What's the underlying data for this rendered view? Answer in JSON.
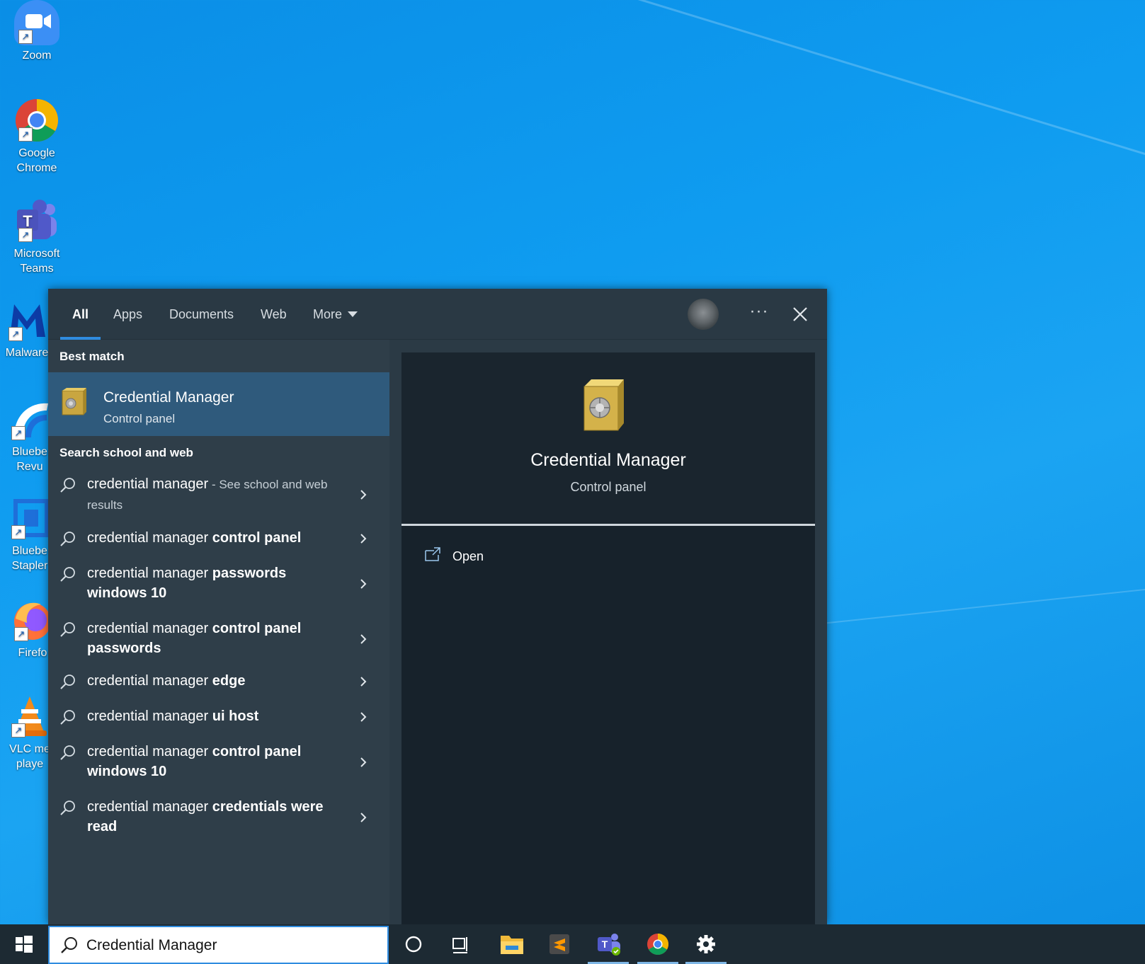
{
  "desktop": {
    "icons": [
      {
        "label": "Zoom"
      },
      {
        "label": "Google\nChrome"
      },
      {
        "label": "Microsoft\nTeams"
      },
      {
        "label": "Malware"
      },
      {
        "label": "Bluebe\nRevu"
      },
      {
        "label": "Bluebe\nStapler"
      },
      {
        "label": "Firefo"
      },
      {
        "label": "VLC me\nplaye"
      }
    ]
  },
  "search_panel": {
    "tabs": [
      {
        "label": "All",
        "active": true
      },
      {
        "label": "Apps"
      },
      {
        "label": "Documents"
      },
      {
        "label": "Web"
      },
      {
        "label": "More"
      }
    ],
    "more_options_label": "···",
    "best_match": {
      "heading": "Best match",
      "title": "Credential Manager",
      "subtitle": "Control panel"
    },
    "web_heading": "Search school and web",
    "results": [
      {
        "prefix": "credential manager",
        "bold": "",
        "hint": " - See school and web results"
      },
      {
        "prefix": "credential manager ",
        "bold": "control panel",
        "hint": ""
      },
      {
        "prefix": "credential manager ",
        "bold": "passwords windows 10",
        "hint": ""
      },
      {
        "prefix": "credential manager ",
        "bold": "control panel passwords",
        "hint": ""
      },
      {
        "prefix": "credential manager ",
        "bold": "edge",
        "hint": ""
      },
      {
        "prefix": "credential manager ",
        "bold": "ui host",
        "hint": ""
      },
      {
        "prefix": "credential manager ",
        "bold": "control panel windows 10",
        "hint": ""
      },
      {
        "prefix": "credential manager ",
        "bold": "credentials were read",
        "hint": ""
      }
    ],
    "preview": {
      "title": "Credential Manager",
      "subtitle": "Control panel",
      "actions": [
        {
          "label": "Open"
        }
      ]
    }
  },
  "taskbar": {
    "search_value": "Credential Manager",
    "accent": "#2f8ce0"
  },
  "colors": {
    "panel_bg": "#2b3a45",
    "selected_bg": "#2f5a7c",
    "preview_bg": "#17222b"
  }
}
